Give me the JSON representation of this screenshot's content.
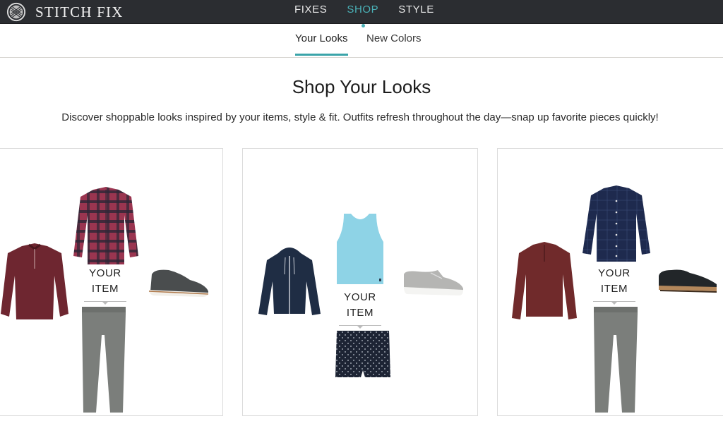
{
  "brand": {
    "name": "STITCH FIX",
    "logo_icon": "stitch-fix-knot-logo"
  },
  "main_nav": {
    "items": [
      {
        "label": "FIXES",
        "active": false
      },
      {
        "label": "SHOP",
        "active": true
      },
      {
        "label": "STYLE",
        "active": false
      }
    ]
  },
  "sub_nav": {
    "items": [
      {
        "label": "Your Looks",
        "active": true
      },
      {
        "label": "New Colors",
        "active": false
      }
    ]
  },
  "page": {
    "title": "Shop Your Looks",
    "subtitle": "Discover shoppable looks inspired by your items, style & fit. Outfits refresh throughout the day—snap up favorite pieces quickly!"
  },
  "colors": {
    "topbar": "#2b2d31",
    "accent": "#4ab1b7"
  },
  "looks": [
    {
      "your_item_label": "YOUR ITEM",
      "your_item_line1": "YOUR",
      "your_item_line2": "ITEM",
      "items": [
        {
          "name": "burgundy quarter-zip pullover",
          "color": "#6e2630"
        },
        {
          "name": "red plaid button-down shirt",
          "color": "#8c2f44"
        },
        {
          "name": "charcoal knit sneaker",
          "color": "#4a4d4e"
        },
        {
          "name": "grey chino pants",
          "color": "#7b7e7b",
          "your_item": true
        }
      ]
    },
    {
      "your_item_label": "YOUR ITEM",
      "your_item_line1": "YOUR",
      "your_item_line2": "ITEM",
      "items": [
        {
          "name": "navy zip hoodie",
          "color": "#1f2d44"
        },
        {
          "name": "light blue tank top",
          "color": "#8ed3e6"
        },
        {
          "name": "grey canvas sneaker",
          "color": "#b5b5b3"
        },
        {
          "name": "navy printed shorts",
          "color": "#1d2434",
          "your_item": true
        }
      ]
    },
    {
      "your_item_label": "YOUR ITEM",
      "your_item_line1": "YOUR",
      "your_item_line2": "ITEM",
      "items": [
        {
          "name": "burgundy quarter-zip sweater",
          "color": "#702a2b"
        },
        {
          "name": "navy check button-down shirt",
          "color": "#1e2a4e"
        },
        {
          "name": "black leather derby shoe",
          "color": "#222629"
        },
        {
          "name": "grey chino pants",
          "color": "#7b7e7b",
          "your_item": true
        }
      ]
    }
  ]
}
